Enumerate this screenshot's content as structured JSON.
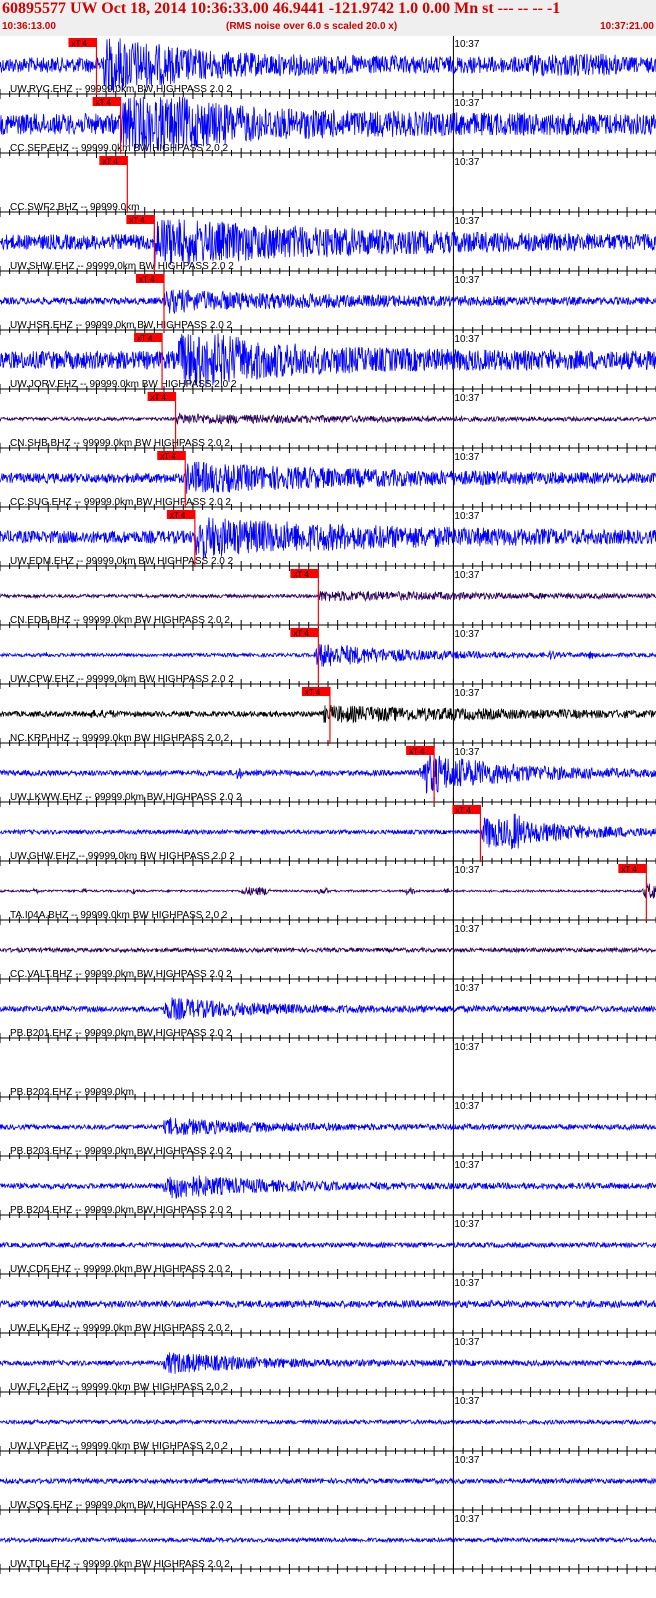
{
  "header": {
    "title": "60895577 UW Oct 18, 2014 10:36:33.00   46.9441 -121.9742  1.0 0.00 Mn st --- -- -- -1",
    "start_time": "10:36:13.00",
    "note": "(RMS noise over 6.0 s scaled 20.0 x)",
    "end_time": "10:37:21.00"
  },
  "colors": {
    "header_bg": "#efefef",
    "header_text": "#d40000",
    "pick": "#ff0000",
    "trace_blue": "#0000ff",
    "trace_purple": "#2a0060",
    "trace_black": "#000000",
    "axis": "#000000"
  },
  "chart_data": {
    "type": "seismogram",
    "time_start": "10:36:13.00",
    "time_end": "10:37:21.00",
    "duration_s": 68,
    "tick_interval_s": 1,
    "minute_label": "10:37",
    "minute_offset_s": 47,
    "pick_label": "xT 4",
    "traces": [
      {
        "label": "UW.RVC.EHZ -- 99999.0km BW  HIGHPASS  2.0  2",
        "color": "blue",
        "amp": 22,
        "pick_s": 10.0,
        "arr": 10.5,
        "peak": 26,
        "bursts": [
          [
            55,
            64,
            1.4
          ]
        ]
      },
      {
        "label": "CC.SEP.EHZ -- 99999.0km BW  HIGHPASS  2.0  2",
        "color": "blue",
        "amp": 30,
        "pick_s": 12.5,
        "arr": 12.5,
        "peak": 34,
        "bursts": []
      },
      {
        "label": "CC.SWF2.BHZ -- 99999.0km",
        "color": "none",
        "amp": 0,
        "pick_s": 13.2,
        "arr": 0,
        "peak": 0,
        "bursts": []
      },
      {
        "label": "UW.SHW.EHZ -- 99999.0km BW  HIGHPASS  2.0  2",
        "color": "blue",
        "amp": 22,
        "pick_s": 16.0,
        "arr": 16.0,
        "peak": 20,
        "bursts": []
      },
      {
        "label": "UW.HSR.EHZ -- 99999.0km BW  HIGHPASS  2.0  2",
        "color": "blue",
        "amp": 10,
        "pick_s": 17.0,
        "arr": 17.0,
        "peak": 10,
        "bursts": []
      },
      {
        "label": "UW.JORV.EHZ -- 99999.0km BW  HIGHPASS  2.0  2",
        "color": "blue",
        "amp": 26,
        "pick_s": 16.8,
        "arr": 18.5,
        "peak": 28,
        "bursts": []
      },
      {
        "label": "CN.SHB.BHZ -- 99999.0km BW  HIGHPASS  2.0  2",
        "color": "purple",
        "amp": 5,
        "pick_s": 18.2,
        "arr": 18.2,
        "peak": 4,
        "bursts": []
      },
      {
        "label": "CC.SUG.EHZ -- 99999.0km BW  HIGHPASS  2.0  2",
        "color": "blue",
        "amp": 14,
        "pick_s": 19.2,
        "arr": 19.2,
        "peak": 14,
        "bursts": []
      },
      {
        "label": "UW.EDM.EHZ -- 99999.0km BW  HIGHPASS  2.0  2",
        "color": "blue",
        "amp": 18,
        "pick_s": 20.2,
        "arr": 20.2,
        "peak": 18,
        "bursts": []
      },
      {
        "label": "CN.EDB.BHZ -- 99999.0km BW  HIGHPASS  2.0  2",
        "color": "purple",
        "amp": 5,
        "pick_s": 33.0,
        "arr": 33.0,
        "peak": 2,
        "bursts": []
      },
      {
        "label": "UW.CPW.EHZ -- 99999.0km BW  HIGHPASS  2.0  2",
        "color": "blue",
        "amp": 5,
        "pick_s": 33.0,
        "arr": 32.5,
        "peak": 12,
        "bursts": [
          [
            4.5,
            5,
            2.5
          ],
          [
            57,
            57.5,
            2
          ],
          [
            61,
            61.5,
            2
          ]
        ]
      },
      {
        "label": "NC.KRP.HHZ -- 99999.0km BW  HIGHPASS  2.0  2",
        "color": "black",
        "amp": 8,
        "pick_s": 34.2,
        "arr": 33.5,
        "peak": 6,
        "bursts": [
          [
            9,
            12,
            1.5
          ]
        ]
      },
      {
        "label": "UW.LKWW.EHZ -- 99999.0km BW  HIGHPASS  2.0  2",
        "color": "blue",
        "amp": 8,
        "pick_s": 45.0,
        "arr": 43.5,
        "peak": 20,
        "bursts": [
          [
            24.5,
            25,
            2.5
          ]
        ]
      },
      {
        "label": "UW.GHW.EHZ -- 99999.0km BW  HIGHPASS  2.0  2",
        "color": "blue",
        "amp": 6,
        "pick_s": 49.8,
        "arr": 49.8,
        "peak": 16,
        "bursts": [
          [
            53,
            54,
            1.5
          ]
        ]
      },
      {
        "label": "TA.I04A.BHZ -- 99999.0km BW  HIGHPASS  2.0  2",
        "color": "purple",
        "amp": 3,
        "pick_s": 67.0,
        "arr": 66.5,
        "peak": 8,
        "bursts": [
          [
            3.5,
            4,
            3
          ],
          [
            8.5,
            9,
            3
          ],
          [
            13.5,
            14,
            3
          ],
          [
            25,
            28,
            4
          ],
          [
            33,
            34,
            3
          ],
          [
            42,
            43,
            3.5
          ],
          [
            46,
            46.5,
            3
          ]
        ]
      },
      {
        "label": "CC.VALT.BHZ -- 99999.0km BW  HIGHPASS  2.0  2",
        "color": "purple",
        "amp": 6,
        "pick_s": null,
        "arr": 0,
        "peak": 0,
        "bursts": []
      },
      {
        "label": "PB.B201.EHZ -- 99999.0km BW  HIGHPASS  2.0  2",
        "color": "blue",
        "amp": 8,
        "pick_s": null,
        "arr": 17.0,
        "peak": 10,
        "bursts": []
      },
      {
        "label": "PB.B202.EHZ -- 99999.0km",
        "color": "none",
        "amp": 0,
        "pick_s": null,
        "arr": 0,
        "peak": 0,
        "bursts": []
      },
      {
        "label": "PB.B203.EHZ -- 99999.0km BW  HIGHPASS  2.0  2",
        "color": "blue",
        "amp": 7,
        "pick_s": null,
        "arr": 17.0,
        "peak": 8,
        "bursts": []
      },
      {
        "label": "PB.B204.EHZ -- 99999.0km BW  HIGHPASS  2.0  2",
        "color": "blue",
        "amp": 8,
        "pick_s": null,
        "arr": 17.0,
        "peak": 12,
        "bursts": []
      },
      {
        "label": "UW.CDF.EHZ -- 99999.0km BW  HIGHPASS  2.0  2",
        "color": "blue",
        "amp": 7,
        "pick_s": null,
        "arr": 0,
        "peak": 0,
        "bursts": []
      },
      {
        "label": "UW.ELK.EHZ -- 99999.0km BW  HIGHPASS  2.0  2",
        "color": "blue",
        "amp": 10,
        "pick_s": null,
        "arr": 0,
        "peak": 0,
        "bursts": []
      },
      {
        "label": "UW.FL2.EHZ -- 99999.0km BW  HIGHPASS  2.0  2",
        "color": "blue",
        "amp": 7,
        "pick_s": null,
        "arr": 17.0,
        "peak": 10,
        "bursts": []
      },
      {
        "label": "UW.LVP.EHZ -- 99999.0km BW  HIGHPASS  2.0  2",
        "color": "blue",
        "amp": 6,
        "pick_s": null,
        "arr": 0,
        "peak": 0,
        "bursts": []
      },
      {
        "label": "UW.SQS.EHZ -- 99999.0km BW  HIGHPASS  2.0  2",
        "color": "blue",
        "amp": 7,
        "pick_s": null,
        "arr": 0,
        "peak": 0,
        "bursts": []
      },
      {
        "label": "UW.TDL.EHZ -- 99999.0km BW  HIGHPASS  2.0  2",
        "color": "blue",
        "amp": 6,
        "pick_s": null,
        "arr": 0,
        "peak": 0,
        "bursts": []
      }
    ]
  }
}
